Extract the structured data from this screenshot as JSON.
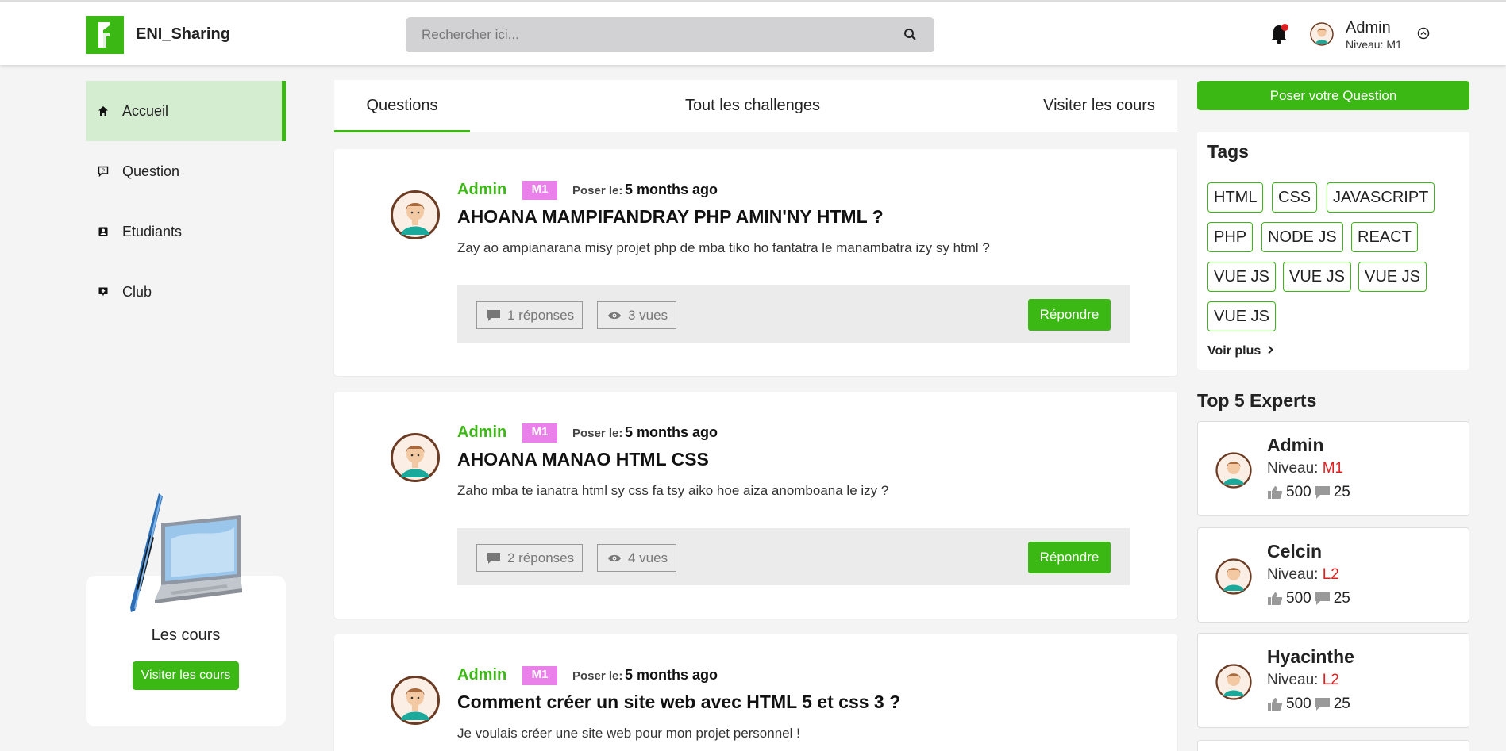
{
  "header": {
    "brand": "ENI_Sharing",
    "search_placeholder": "Rechercher ici...",
    "user": {
      "name": "Admin",
      "level": "Niveau: M1"
    }
  },
  "sidebar": {
    "items": [
      {
        "label": "Accueil",
        "icon": "home-icon",
        "active": true
      },
      {
        "label": "Question",
        "icon": "question-icon",
        "active": false
      },
      {
        "label": "Etudiants",
        "icon": "contact-icon",
        "active": false
      },
      {
        "label": "Club",
        "icon": "club-icon",
        "active": false
      }
    ],
    "courses": {
      "title": "Les cours",
      "button": "Visiter les cours"
    }
  },
  "tabs": [
    {
      "label": "Questions",
      "active": true
    },
    {
      "label": "Tout les challenges",
      "active": false
    },
    {
      "label": "Visiter les cours",
      "active": false
    }
  ],
  "questions": [
    {
      "author": "Admin",
      "level": "M1",
      "posted_label": "Poser le:",
      "posted_time": "5 months ago",
      "title": "AHOANA MAMPIFANDRAY PHP AMIN'NY HTML ?",
      "body": "Zay ao ampianarana misy projet php de mba tiko ho fantatra le manambatra izy sy html ?",
      "replies": "1 réponses",
      "views": "3 vues",
      "reply_button": "Répondre"
    },
    {
      "author": "Admin",
      "level": "M1",
      "posted_label": "Poser le:",
      "posted_time": "5 months ago",
      "title": "AHOANA MANAO HTML CSS",
      "body": "Zaho mba te ianatra html sy css fa tsy aiko hoe aiza anomboana le izy ?",
      "replies": "2 réponses",
      "views": "4 vues",
      "reply_button": "Répondre"
    },
    {
      "author": "Admin",
      "level": "M1",
      "posted_label": "Poser le:",
      "posted_time": "5 months ago",
      "title": "Comment créer un site web avec HTML 5 et css 3 ?",
      "body": "Je voulais créer une site web pour mon projet personnel !"
    }
  ],
  "right": {
    "ask_button": "Poser votre Question",
    "tags_title": "Tags",
    "tags": [
      "HTML",
      "CSS",
      "JAVASCRIPT",
      "PHP",
      "NODE JS",
      "REACT",
      "VUE JS",
      "VUE JS",
      "VUE JS",
      "VUE JS"
    ],
    "see_more": "Voir plus",
    "experts_title": "Top 5 Experts",
    "experts": [
      {
        "name": "Admin",
        "level_label": "Niveau:",
        "level": "M1",
        "likes": "500",
        "comments": "25"
      },
      {
        "name": "Celcin",
        "level_label": "Niveau:",
        "level": "L2",
        "likes": "500",
        "comments": "25"
      },
      {
        "name": "Hyacinthe",
        "level_label": "Niveau:",
        "level": "L2",
        "likes": "500",
        "comments": "25"
      }
    ]
  },
  "colors": {
    "accent": "#3cb815",
    "badge": "#ea80ea",
    "level_red": "#e02020",
    "active_bg": "#d4ecd0"
  }
}
